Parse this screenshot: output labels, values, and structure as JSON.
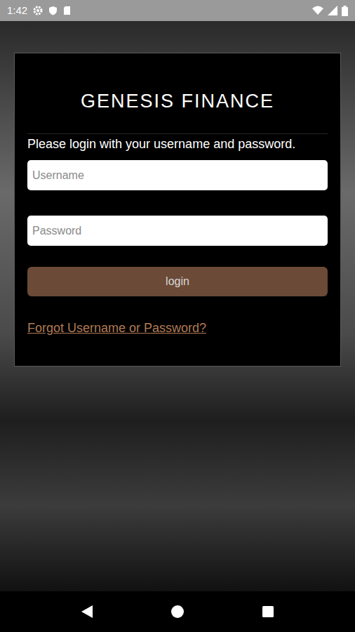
{
  "status_bar": {
    "time": "1:42"
  },
  "login_card": {
    "logo": "GENESIS FINANCE",
    "prompt": "Please login with your username and password.",
    "fields": [
      {
        "placeholder": "Username"
      },
      {
        "placeholder": "Password"
      }
    ],
    "button": "login",
    "link": "Forgot Username or Password?"
  }
}
